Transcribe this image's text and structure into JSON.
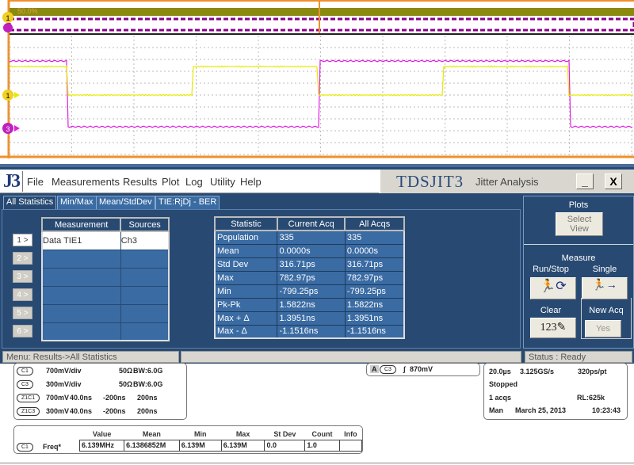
{
  "scope": {
    "overview_zoom_label": "50.0%",
    "ch1_marker": "1",
    "ch3_marker": "3",
    "colors": {
      "ch1": "#e8e800",
      "ch3": "#e020e0",
      "frame": "#f0902a"
    }
  },
  "app": {
    "logo": "J3",
    "menu": [
      "File",
      "Measurements",
      "Results",
      "Plot",
      "Log",
      "Utility",
      "Help"
    ],
    "title": "TDSJIT3",
    "subtitle": "Jitter Analysis",
    "minimize": "_",
    "close": "X"
  },
  "tabs": [
    "All Statistics",
    "Min/Max",
    "Mean/StdDev",
    "TIE:RjDj - BER"
  ],
  "measurements": {
    "headers": [
      "Measurement",
      "Sources"
    ],
    "row_buttons": [
      "1 >",
      "2 >",
      "3 >",
      "4 >",
      "5 >",
      "6 >"
    ],
    "rows": [
      [
        "Data TIE1",
        "Ch3"
      ],
      [
        "",
        ""
      ],
      [
        "",
        ""
      ],
      [
        "",
        ""
      ],
      [
        "",
        ""
      ],
      [
        "",
        ""
      ]
    ]
  },
  "statistics": {
    "headers": [
      "Statistic",
      "Current Acq",
      "All Acqs"
    ],
    "rows": [
      [
        "Population",
        "335",
        "335"
      ],
      [
        "Mean",
        "0.0000s",
        "0.0000s"
      ],
      [
        "Std Dev",
        "316.71ps",
        "316.71ps"
      ],
      [
        "Max",
        "782.97ps",
        "782.97ps"
      ],
      [
        "Min",
        "-799.25ps",
        "-799.25ps"
      ],
      [
        "Pk-Pk",
        "1.5822ns",
        "1.5822ns"
      ],
      [
        "Max + Δ",
        "1.3951ns",
        "1.3951ns"
      ],
      [
        "Max - Δ",
        "-1.1516ns",
        "-1.1516ns"
      ]
    ]
  },
  "right_panel": {
    "plots_label": "Plots",
    "select_view": "Select View",
    "measure_label": "Measure",
    "run_stop": "Run/Stop",
    "single": "Single",
    "clear": "Clear",
    "clear_icon_text": "123",
    "new_acq": "New Acq",
    "yes": "Yes"
  },
  "status": {
    "menu": "Menu: Results->All Statistics",
    "status": "Status : Ready"
  },
  "channels": [
    {
      "chip": "C1",
      "a": "700mV/div",
      "b": "50Ω",
      "c": "BW:6.0G"
    },
    {
      "chip": "C3",
      "a": "300mV/div",
      "b": "50Ω",
      "c": "BW:6.0G"
    },
    {
      "chip": "Z1C1",
      "a": "700mV",
      "b": "40.0ns",
      "c": "-200ns",
      "d": "200ns"
    },
    {
      "chip": "Z1C3",
      "a": "300mV",
      "b": "40.0ns",
      "c": "-200ns",
      "d": "200ns"
    }
  ],
  "trigger": {
    "mode": "A",
    "source": "C3",
    "level": "870mV"
  },
  "acquisition": {
    "timebase": "20.0µs",
    "rate": "3.125GS/s",
    "res": "320ps/pt",
    "state": "Stopped",
    "acqs": "1 acqs",
    "rl": "RL:625k",
    "mode": "Man",
    "date": "March 25, 2013",
    "time": "10:23:43"
  },
  "freq": {
    "headers": [
      "Value",
      "Mean",
      "Min",
      "Max",
      "St Dev",
      "Count",
      "Info"
    ],
    "chip": "C1",
    "label": "Freq*",
    "values": [
      "6.139MHz",
      "6.1386852M",
      "6.139M",
      "6.139M",
      "0.0",
      "1.0",
      ""
    ]
  }
}
